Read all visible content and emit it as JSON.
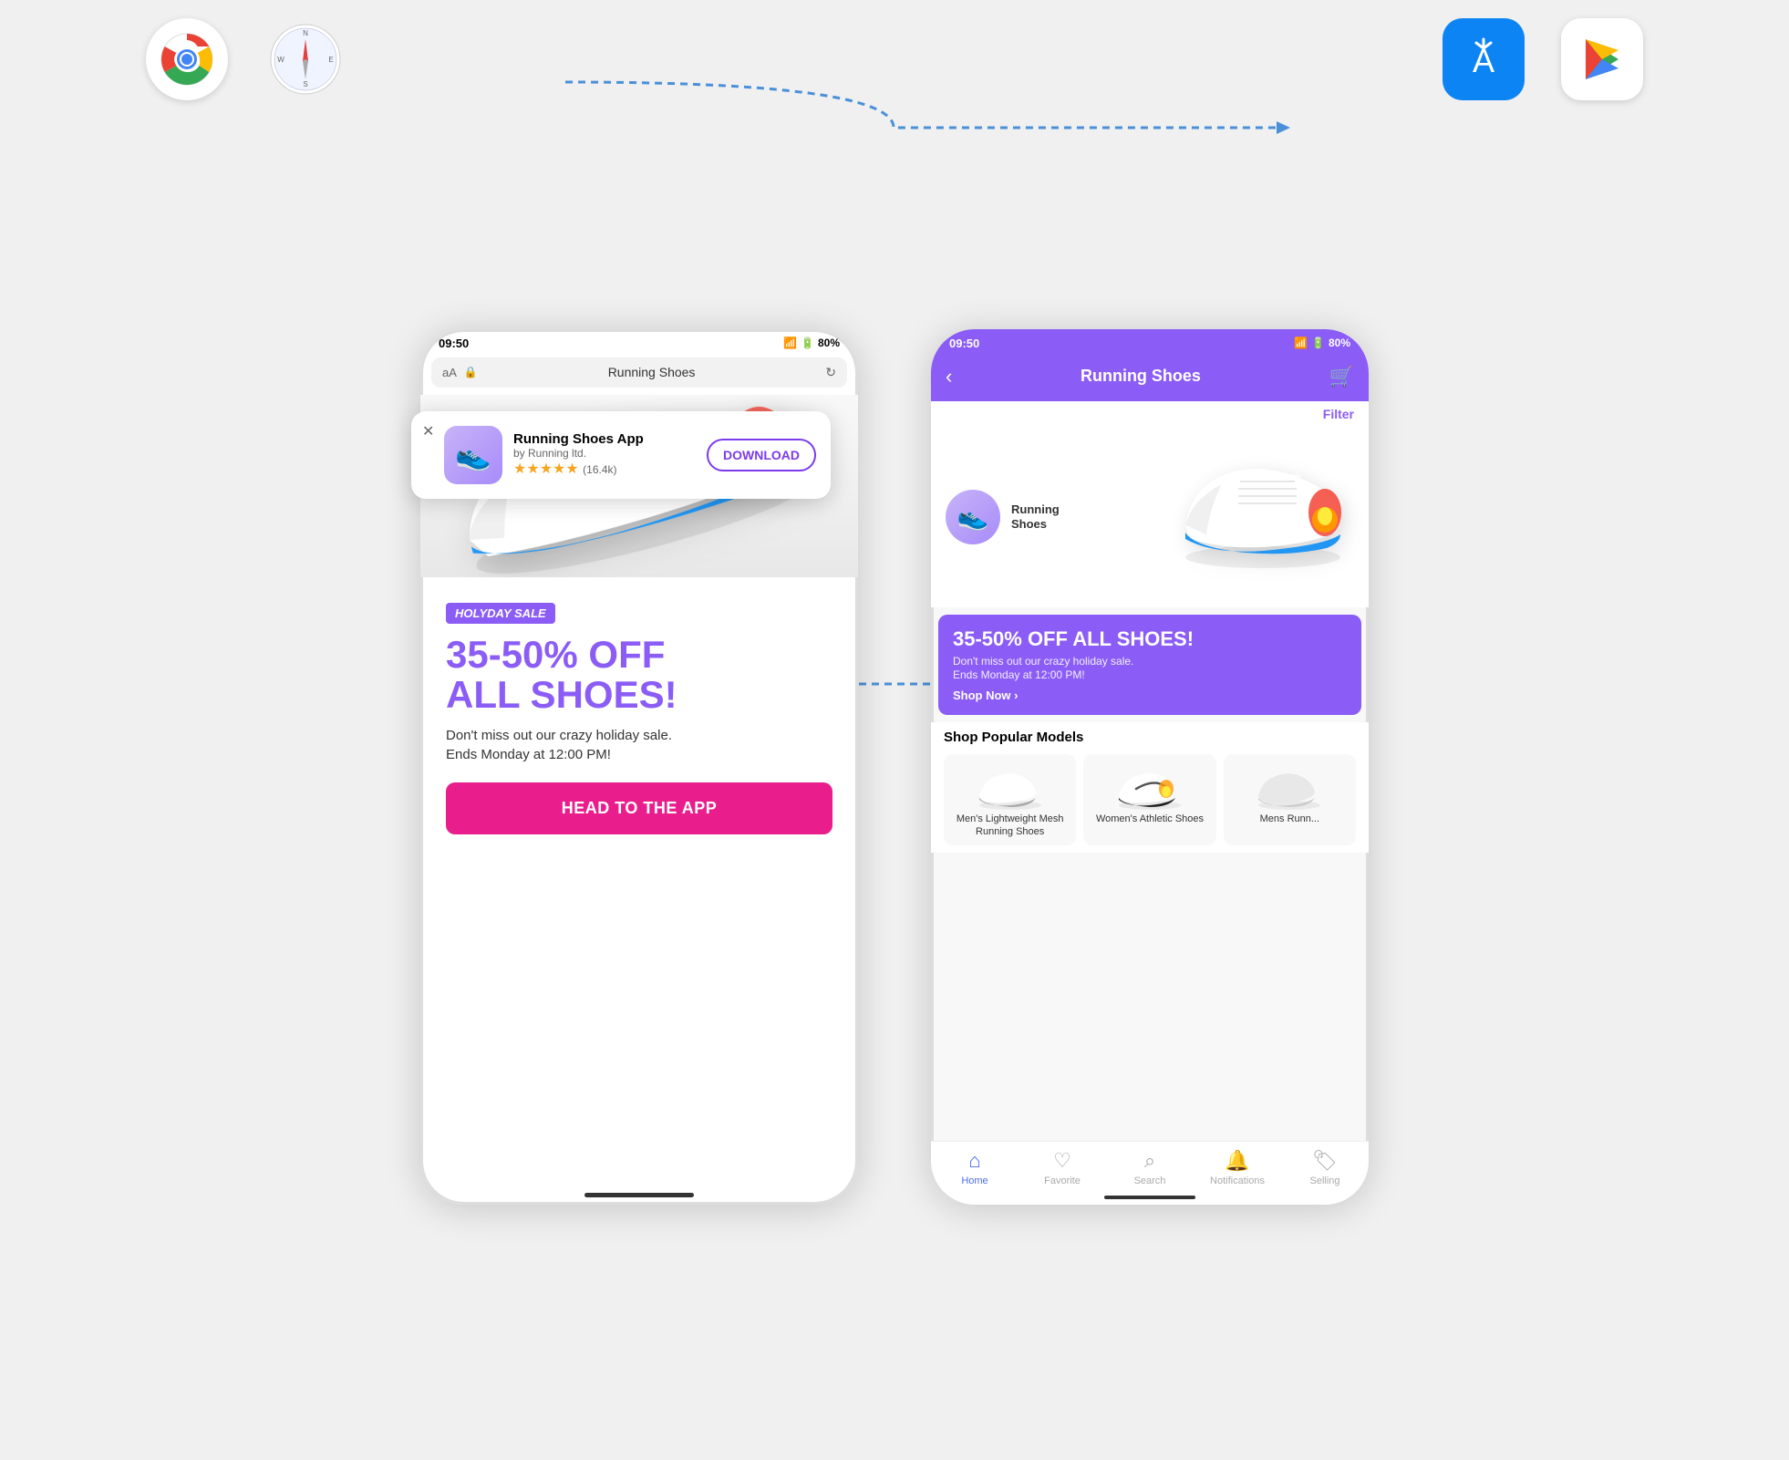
{
  "top": {
    "left_icons": [
      {
        "name": "Chrome",
        "emoji": "🌐"
      },
      {
        "name": "Safari",
        "emoji": "🧭"
      }
    ],
    "right_icons": [
      {
        "name": "App Store",
        "emoji": "🔷"
      },
      {
        "name": "Google Play",
        "emoji": "▶"
      }
    ]
  },
  "left_phone": {
    "status": {
      "time": "09:50",
      "battery": "80%"
    },
    "browser": {
      "aa": "aA",
      "lock": "🔒",
      "url": "Running Shoes",
      "refresh": "↻"
    },
    "banner": {
      "close": "✕",
      "app_name": "Running Shoes App",
      "app_by": "by Running ltd.",
      "stars": "★★★★★",
      "reviews": "(16.4k)",
      "download_label": "DOWNLOAD"
    },
    "sale": {
      "holiday_badge": "HOLYDAY SALE",
      "title_line1": "35-50% OFF",
      "title_line2": "ALL SHOES!",
      "description": "Don't miss out our crazy holiday sale.\nEnds Monday at 12:00 PM!",
      "cta": "HEAD TO THE APP"
    }
  },
  "right_phone": {
    "status": {
      "time": "09:50",
      "battery": "80%"
    },
    "header": {
      "back": "‹",
      "title": "Running Shoes",
      "cart": "🛒"
    },
    "filter": "Filter",
    "hero": {
      "avatar_label": "Running\nShoes"
    },
    "sale_banner": {
      "title": "35-50% OFF ALL SHOES!",
      "description": "Don't miss out our crazy holiday sale.\nEnds Monday at 12:00 PM!",
      "shop_now": "Shop Now ›"
    },
    "popular_section": {
      "title": "Shop Popular Models",
      "models": [
        {
          "name": "Men's Lightweight Mesh Running Shoes",
          "emoji": "👟"
        },
        {
          "name": "Women's Athletic Shoes",
          "emoji": "👟"
        },
        {
          "name": "Mens Runn...",
          "emoji": "👟"
        }
      ]
    },
    "bottom_nav": [
      {
        "label": "Home",
        "icon": "🏠",
        "active": true
      },
      {
        "label": "Favorite",
        "icon": "♡",
        "active": false
      },
      {
        "label": "Search",
        "icon": "🔍",
        "active": false
      },
      {
        "label": "Notifications",
        "icon": "🔔",
        "active": false
      },
      {
        "label": "Selling",
        "icon": "🏷",
        "active": false
      }
    ]
  }
}
